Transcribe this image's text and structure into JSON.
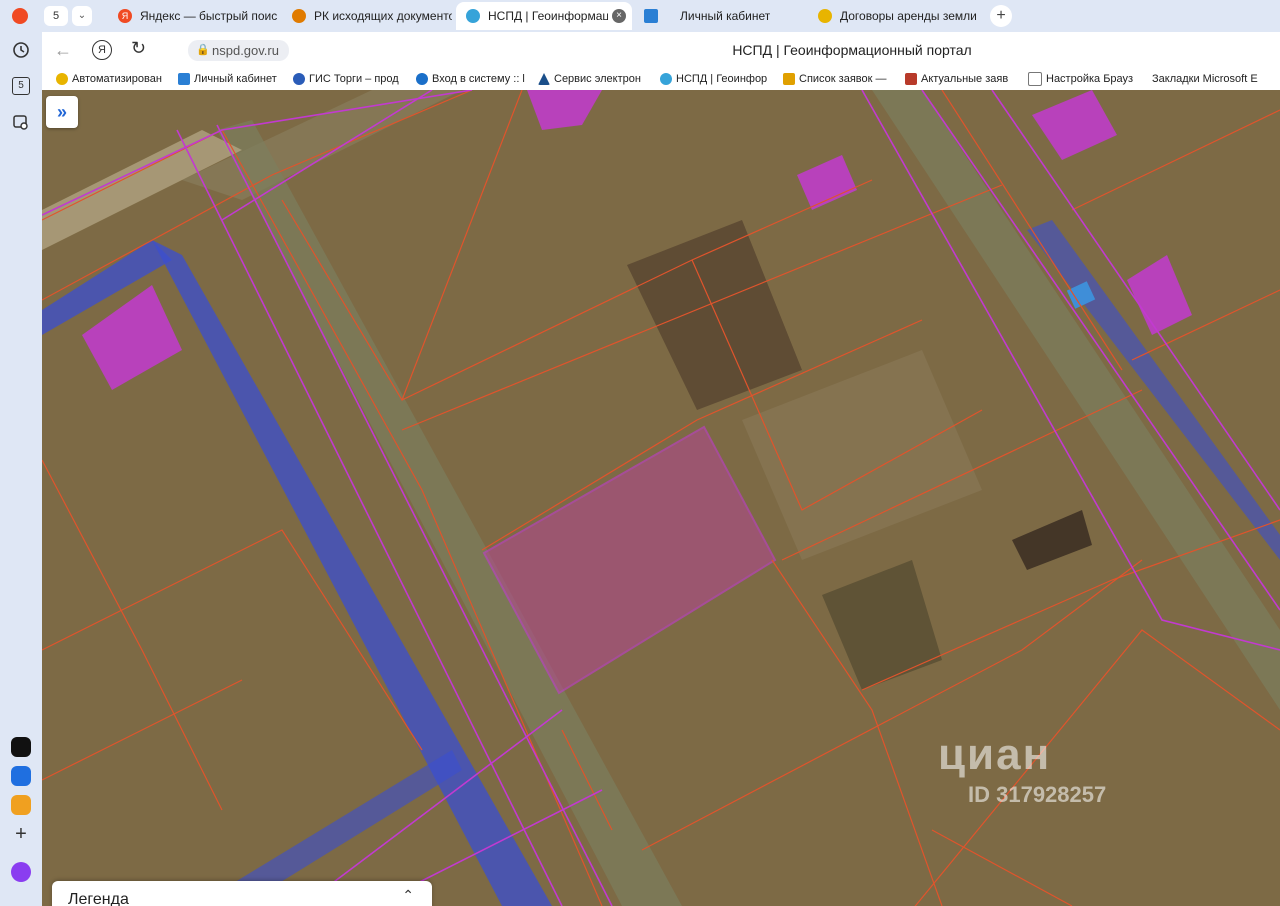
{
  "browser": {
    "tab_counter": "5",
    "tabs": [
      {
        "label": "Яндекс — быстрый поиск",
        "icon": "yandex-icon",
        "active": false
      },
      {
        "label": "РК исходящих документов",
        "icon": "doc-icon",
        "active": false
      },
      {
        "label": "НСПД | Геоинформационный портал",
        "icon": "nspd-icon",
        "active": true
      },
      {
        "label": "Личный кабинет",
        "icon": "cabinet-icon",
        "active": false
      },
      {
        "label": "Договоры аренды земли",
        "icon": "contract-icon",
        "active": false
      }
    ],
    "new_tab": "+",
    "url": "nspd.gov.ru",
    "page_title": "НСПД | Геоинформационный портал",
    "bookmarks": [
      {
        "label": "Автоматизирован",
        "color": "#e8b400"
      },
      {
        "label": "Личный кабинет",
        "color": "#2a7fd4"
      },
      {
        "label": "ГИС Торги – прод",
        "color": "#2a5cb8"
      },
      {
        "label": "Вход в систему :: l",
        "color": "#1a6fc9"
      },
      {
        "label": "Сервис электрон",
        "color": "#1b4f8a"
      },
      {
        "label": "НСПД | Геоинфор",
        "color": "#36a3d9"
      },
      {
        "label": "Список заявок —",
        "color": "#e0a000"
      },
      {
        "label": "Актуальные заяв",
        "color": "#b83a2a"
      },
      {
        "label": "Настройка Брауз",
        "color": "#777777"
      },
      {
        "label": "Закладки Microsoft E",
        "color": "#ffffff"
      }
    ],
    "sidebar_badge": "5"
  },
  "map": {
    "expand_glyph": "»",
    "legend_title": "Легенда",
    "legend_toggle": "⌃",
    "watermark_brand": "циан",
    "watermark_id": "ID 317928257"
  },
  "colors": {
    "parcel_line": "#e0542c",
    "boundary_line": "#c23ad0",
    "zone_fill": "#3b4fd0",
    "building_fill": "#c23ad0",
    "selected_fill": "#b04a8c"
  }
}
